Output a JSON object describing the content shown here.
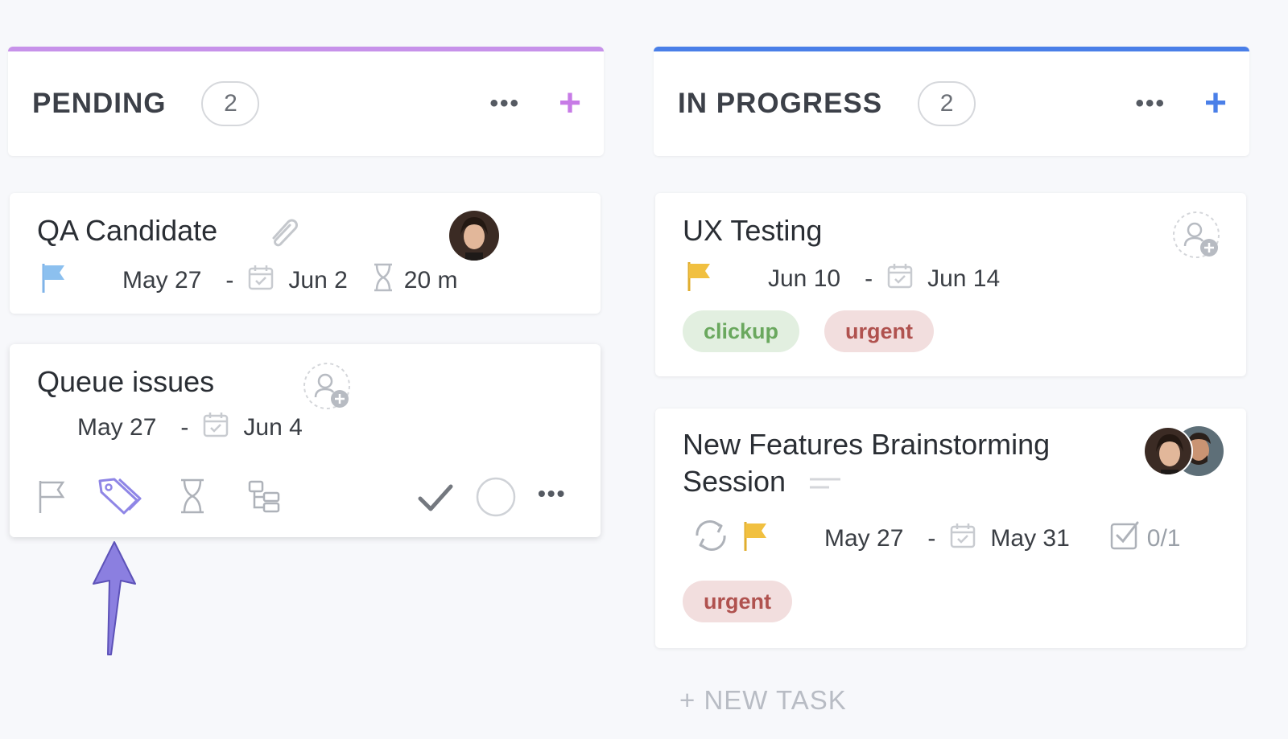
{
  "colors": {
    "pending_accent": "#c792ea",
    "progress_accent": "#4a7fe8",
    "tag_clickup_bg": "#e2efe0",
    "tag_clickup_text": "#6aa85e",
    "tag_urgent_bg": "#f2dede",
    "tag_urgent_text": "#b0524f",
    "arrow": "#8b7fe0"
  },
  "columns": [
    {
      "title": "PENDING",
      "count": "2",
      "more": "•••",
      "add": "+",
      "cards": [
        {
          "title": "QA Candidate",
          "start": "May 27",
          "due": "Jun 2",
          "estimate": "20 m",
          "icons": [
            "paperclip-icon",
            "flag-icon",
            "calendar-icon",
            "hourglass-icon",
            "avatar"
          ]
        },
        {
          "title": "Queue issues",
          "start": "May 27",
          "due": "Jun 4",
          "icons": [
            "assign-user-icon",
            "flag-icon",
            "tag-icon",
            "hourglass-icon",
            "subtasks-icon",
            "check-icon",
            "status-circle-icon",
            "more-icon"
          ],
          "more": "•••"
        }
      ]
    },
    {
      "title": "IN PROGRESS",
      "count": "2",
      "more": "•••",
      "add": "+",
      "cards": [
        {
          "title": "UX Testing",
          "start": "Jun 10",
          "due": "Jun 14",
          "tags": [
            "clickup",
            "urgent"
          ],
          "icons": [
            "assign-user-icon",
            "flag-icon",
            "calendar-icon"
          ]
        },
        {
          "title_line1": "New Features Brainstorming",
          "title_line2": "Session",
          "start": "May 27",
          "due": "May 31",
          "checklist": "0/1",
          "tags": [
            "urgent"
          ],
          "icons": [
            "description-icon",
            "recurring-icon",
            "flag-icon",
            "calendar-icon",
            "checklist-icon",
            "avatar-group"
          ]
        }
      ],
      "new_task": "+ NEW TASK"
    }
  ]
}
